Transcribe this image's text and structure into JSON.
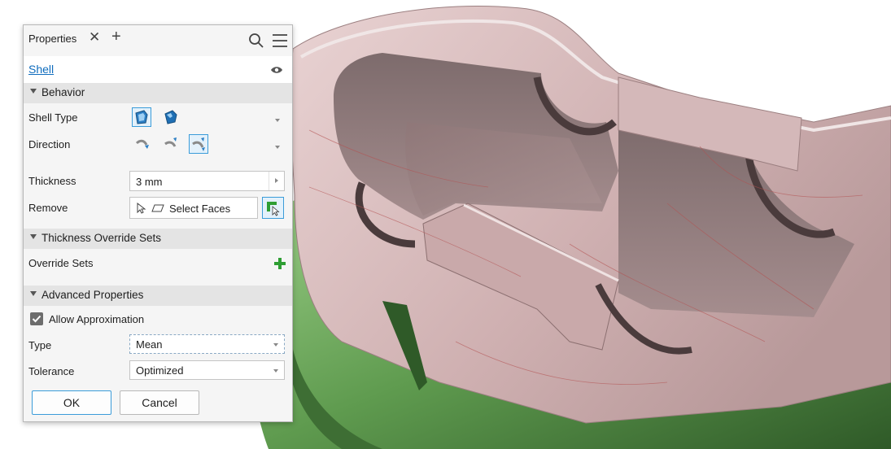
{
  "panel": {
    "tab_label": "Properties",
    "feature_name": "Shell",
    "sections": {
      "behavior": "Behavior",
      "thickness_override": "Thickness Override Sets",
      "advanced": "Advanced Properties"
    },
    "rows": {
      "shell_type": "Shell Type",
      "direction": "Direction",
      "thickness": "Thickness",
      "thickness_value": "3 mm",
      "remove": "Remove",
      "remove_value": "Select Faces",
      "override_sets": "Override Sets",
      "allow_approx": "Allow Approximation",
      "type": "Type",
      "type_value": "Mean",
      "tolerance": "Tolerance",
      "tolerance_value": "Optimized"
    },
    "buttons": {
      "ok": "OK",
      "cancel": "Cancel"
    }
  },
  "icons": [
    "close-icon",
    "add-tab-icon",
    "search-icon",
    "menu-icon",
    "eye-icon",
    "shell-type-icon",
    "direction-icon",
    "select-cursor-icon",
    "face-icon",
    "select-faces-icon",
    "add-icon",
    "checkbox-icon"
  ],
  "colors": {
    "accent": "#0f6cbd",
    "selection_border": "#3b9cd9",
    "add_green": "#2e9e33",
    "model_green": "#5f9b4f",
    "model_pink": "#d7b7b8"
  }
}
